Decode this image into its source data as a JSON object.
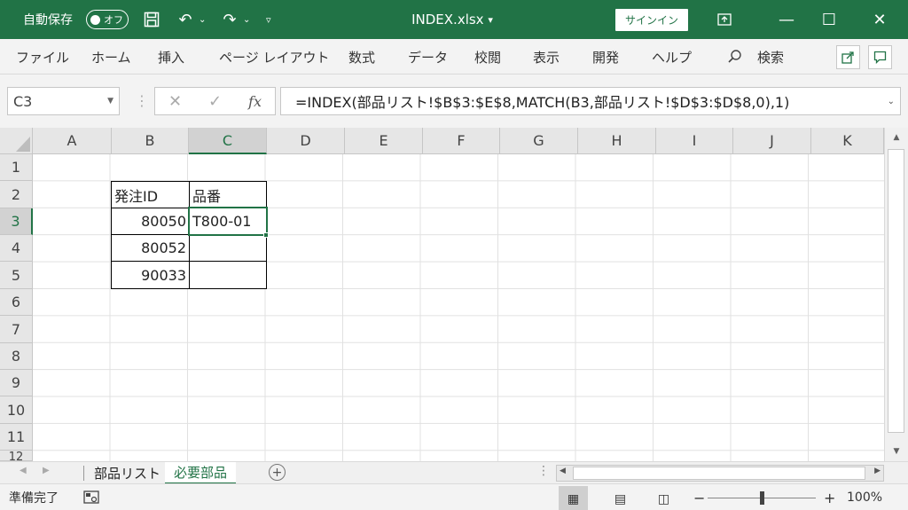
{
  "titlebar": {
    "autosave_label": "自動保存",
    "autosave_state": "オフ",
    "file_name": "INDEX.xlsx",
    "file_caret": "▾",
    "signin": "サインイン"
  },
  "menu": {
    "items": [
      "ファイル",
      "ホーム",
      "挿入",
      "ページ レイアウト",
      "数式",
      "データ",
      "校閲",
      "表示",
      "開発",
      "ヘルプ"
    ],
    "search": "検索"
  },
  "formula_bar": {
    "name_box": "C3",
    "formula": "=INDEX(部品リスト!$B$3:$E$8,MATCH(B3,部品リスト!$D$3:$D$8,0),1)",
    "fx": "fx"
  },
  "grid": {
    "columns": [
      "A",
      "B",
      "C",
      "D",
      "E",
      "F",
      "G",
      "H",
      "I",
      "J",
      "K"
    ],
    "rows": [
      "1",
      "2",
      "3",
      "4",
      "5",
      "6",
      "7",
      "8",
      "9",
      "10",
      "11",
      "12"
    ],
    "selected_cell": "C3",
    "table": {
      "header": [
        "発注ID",
        "品番"
      ],
      "rows": [
        {
          "id": "80050",
          "part": "T800-01"
        },
        {
          "id": "80052",
          "part": ""
        },
        {
          "id": "90033",
          "part": ""
        }
      ]
    }
  },
  "sheets": {
    "tabs": [
      "部品リスト",
      "必要部品"
    ],
    "active": "必要部品",
    "add": "+"
  },
  "status": {
    "ready": "準備完了",
    "zoom_minus": "−",
    "zoom_plus": "+",
    "zoom": "100%"
  }
}
